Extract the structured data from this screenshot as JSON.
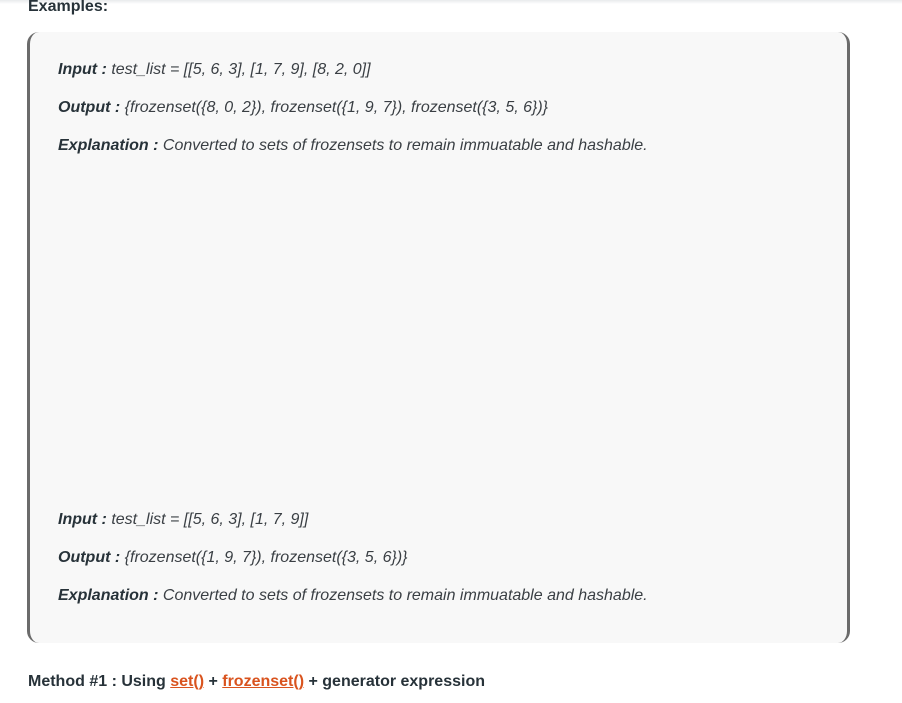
{
  "examples_heading": "Examples:",
  "examples": [
    {
      "input_label": "Input :",
      "input_value": " test_list = [[5, 6, 3], [1, 7, 9], [8, 2, 0]]",
      "output_label": "Output :",
      "output_value": " {frozenset({8, 0, 2}), frozenset({1, 9, 7}), frozenset({3, 5, 6})}",
      "explanation_label": "Explanation :",
      "explanation_value": " Converted to sets of frozensets to remain immuatable and hashable."
    },
    {
      "input_label": "Input :",
      "input_value": " test_list = [[5, 6, 3], [1, 7, 9]]",
      "output_label": "Output :",
      "output_value": " {frozenset({1, 9, 7}), frozenset({3, 5, 6})}",
      "explanation_label": "Explanation :",
      "explanation_value": " Converted to sets of frozensets to remain immuatable and hashable."
    }
  ],
  "method": {
    "prefix": "Method #1 : Using",
    "link1": "set()",
    "join1": " + ",
    "link2": "frozenset()",
    "suffix": " + generator expression"
  },
  "colors": {
    "link": "#d9531e",
    "box_background": "#f8f8f8",
    "box_border": "#6b6b6b"
  }
}
